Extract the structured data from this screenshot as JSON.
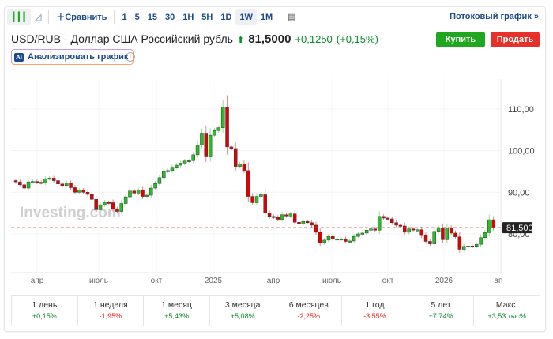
{
  "toolbar": {
    "compare": "Сравнить",
    "intervals": [
      "1",
      "5",
      "15",
      "30",
      "1H",
      "5H",
      "1D",
      "1W",
      "1M"
    ],
    "active_interval": "1W",
    "stream": "Потоковый график »"
  },
  "instrument": {
    "title": "USD/RUB - Доллар США Российский рубль",
    "price": "81,5000",
    "change": "+0,1250",
    "change_pct": "(+0,15%)",
    "direction": "up"
  },
  "actions": {
    "buy": "Купить",
    "sell": "Продать",
    "analyze": "Анализировать график",
    "ai_badge": "AI"
  },
  "colors": {
    "up": "#22c322",
    "down": "#e00000",
    "buy": "#1fa81f",
    "sell": "#e8302a",
    "accent": "#1a4a8c"
  },
  "watermark": "Investing.com",
  "chart_data": {
    "type": "candlestick",
    "interval": "1W",
    "y_ticks": [
      "110,00",
      "100,00",
      "90,00",
      "80,00"
    ],
    "ylim": [
      72,
      117
    ],
    "x_ticks": [
      "апр",
      "июль",
      "окт",
      "2025",
      "апр",
      "июль",
      "окт",
      "2026",
      "ап"
    ],
    "last_price_label": "81,500",
    "last_price": 81.5,
    "first_open": 92.8,
    "closes": [
      92.5,
      91.8,
      91.0,
      92.5,
      92.6,
      92.4,
      92.3,
      93.2,
      93.4,
      92.8,
      92.0,
      91.6,
      92.2,
      91.1,
      90.0,
      90.5,
      90.0,
      89.5,
      88.3,
      85.8,
      87.0,
      87.6,
      87.5,
      86.0,
      85.4,
      87.3,
      88.9,
      90.3,
      89.8,
      90.5,
      89.0,
      89.3,
      91.0,
      92.1,
      93.5,
      95.0,
      95.2,
      96.0,
      96.5,
      97.0,
      97.5,
      97.6,
      99.0,
      101.4,
      104.2,
      98.5,
      103.7,
      104.8,
      105.5,
      110.5,
      100.9,
      100.5,
      96.2,
      96.8,
      95.2,
      89.0,
      87.5,
      89.0,
      89.4,
      85.0,
      84.2,
      84.0,
      83.5,
      84.6,
      84.3,
      84.8,
      82.8,
      82.4,
      83.0,
      82.7,
      82.1,
      80.4,
      77.9,
      78.5,
      79.4,
      78.8,
      78.8,
      78.8,
      78.2,
      78.3,
      79.4,
      80.0,
      80.2,
      80.9,
      81.2,
      80.9,
      84.2,
      83.8,
      83.6,
      82.7,
      82.1,
      81.9,
      80.4,
      81.2,
      81.0,
      81.0,
      79.6,
      78.2,
      77.6,
      80.6,
      81.4,
      78.6,
      81.4,
      80.2,
      79.3,
      76.3,
      77.0,
      77.1,
      77.0,
      77.5,
      79.1,
      80.3,
      83.4,
      81.5
    ]
  },
  "performance": [
    {
      "label": "1 день",
      "value": "+0,15%",
      "dir": "up"
    },
    {
      "label": "1 неделя",
      "value": "-1,95%",
      "dir": "down"
    },
    {
      "label": "1 месяц",
      "value": "+5,43%",
      "dir": "up"
    },
    {
      "label": "3 месяца",
      "value": "+5,08%",
      "dir": "up"
    },
    {
      "label": "6 месяцев",
      "value": "-2,25%",
      "dir": "down"
    },
    {
      "label": "1 год",
      "value": "-3,55%",
      "dir": "down"
    },
    {
      "label": "5 лет",
      "value": "+7,74%",
      "dir": "up"
    },
    {
      "label": "Макс.",
      "value": "+3,53 тыс%",
      "dir": "up"
    }
  ]
}
